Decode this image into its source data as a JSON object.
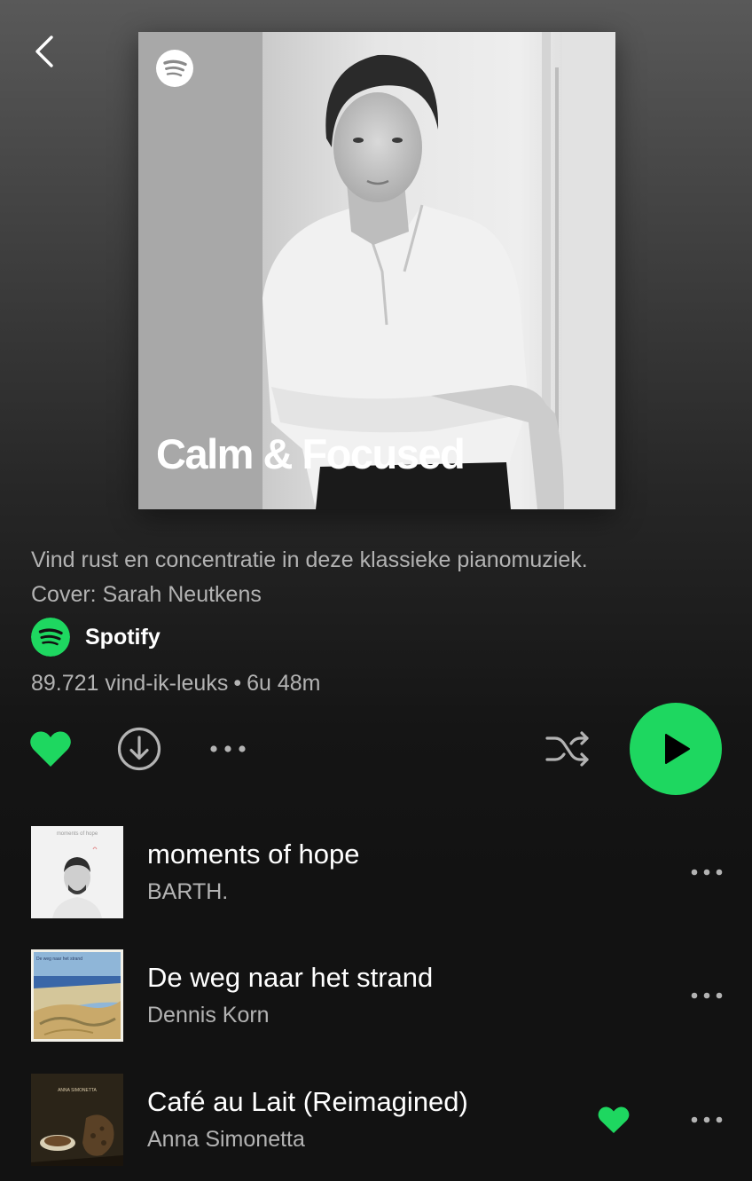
{
  "header": {
    "back_icon": "chevron-left-icon"
  },
  "playlist": {
    "cover_title": "Calm & Focused",
    "description_line1": "Vind rust en concentratie in deze klassieke pianomuziek.",
    "description_line2": "Cover: Sarah Neutkens",
    "owner": "Spotify",
    "likes": "89.721 vind-ik-leuks",
    "separator": "•",
    "duration": "6u 48m",
    "liked": true
  },
  "controls": {
    "heart_icon": "heart-filled-icon",
    "download_icon": "download-icon",
    "more_icon": "more-horizontal-icon",
    "shuffle_icon": "shuffle-icon",
    "play_icon": "play-icon"
  },
  "tracks": [
    {
      "title": "moments of hope",
      "artist": "BARTH.",
      "cover_text": "moments of hope",
      "liked": false
    },
    {
      "title": "De weg naar het strand",
      "artist": "Dennis Korn",
      "cover_text": "De weg naar het strand",
      "liked": false
    },
    {
      "title": "Café au Lait (Reimagined)",
      "artist": "Anna Simonetta",
      "cover_text": "ANNA SIMONETTA",
      "liked": true
    }
  ],
  "colors": {
    "accent": "#1ed760",
    "text_primary": "#ffffff",
    "text_secondary": "#b3b3b3",
    "background": "#121212"
  }
}
